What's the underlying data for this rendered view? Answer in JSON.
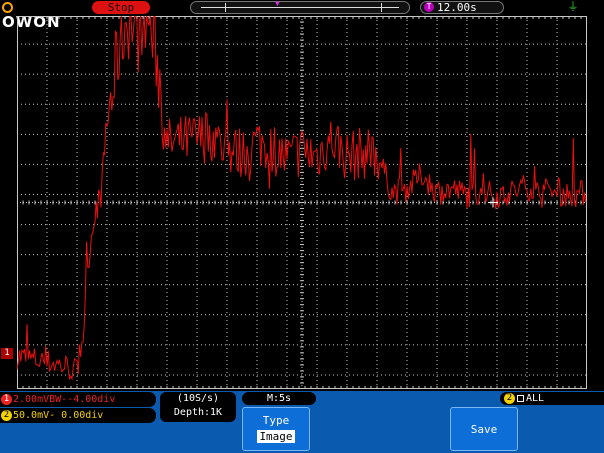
{
  "header": {
    "logo": "OWON",
    "run_state": "Stop",
    "timebase_icon": "T",
    "trigger_time": "12.00s",
    "usb_icon": "usb-icon"
  },
  "screen": {
    "channel_marker": "1",
    "trace_color": "#e81010",
    "grid_color": "#c8c8c8"
  },
  "status": {
    "ch1_index": "1",
    "ch1_text": "2.00mVBW--4.00div",
    "ch2_index": "2",
    "ch2_text": "50.0mV-  0.00div",
    "sample_rate": "(10S/s)",
    "depth": "Depth:1K",
    "memory": "M:5s",
    "trigger_index": "2",
    "trigger_text": "ALL"
  },
  "menu": {
    "type_label": "Type",
    "type_value": "Image",
    "save_label": "Save"
  },
  "chart_data": {
    "type": "line",
    "series": [
      {
        "color": "#e81010",
        "x_divisions": [
          0,
          0.5,
          1,
          1.5,
          2,
          2.2,
          2.4,
          2.6,
          2.8,
          3,
          3.2,
          3.4,
          3.6,
          3.8,
          4,
          4.2,
          4.4,
          4.6,
          4.8,
          5,
          5.5,
          6,
          6.5,
          7,
          7.5,
          8,
          8.5,
          9,
          9.5,
          10,
          10.5,
          11,
          11.5,
          12,
          12.5,
          13,
          13.5,
          14,
          14.5,
          15,
          15.5,
          16,
          16.5,
          17,
          17.5,
          18,
          18.5,
          19
        ],
        "y_divisions": [
          -4.9,
          -5.0,
          -5.1,
          -5.2,
          -5.4,
          -4.2,
          -1.5,
          0,
          0.5,
          3,
          4,
          5.5,
          6.2,
          6.5,
          5.8,
          6.5,
          6.4,
          5.5,
          4,
          2.2,
          2.3,
          2.4,
          2.5,
          2.0,
          1.9,
          2.3,
          2.1,
          1.7,
          2.0,
          1.8,
          2.4,
          1.8,
          1.9,
          1.9,
          0.6,
          0.7,
          1.2,
          0.6,
          0.7,
          0.5,
          0.6,
          0.5,
          0.6,
          0.8,
          0.5,
          0.6,
          0.5,
          0.6
        ]
      }
    ],
    "xlim": [
      0,
      19
    ],
    "ylim": [
      -6,
      6.5
    ],
    "grid": true
  }
}
